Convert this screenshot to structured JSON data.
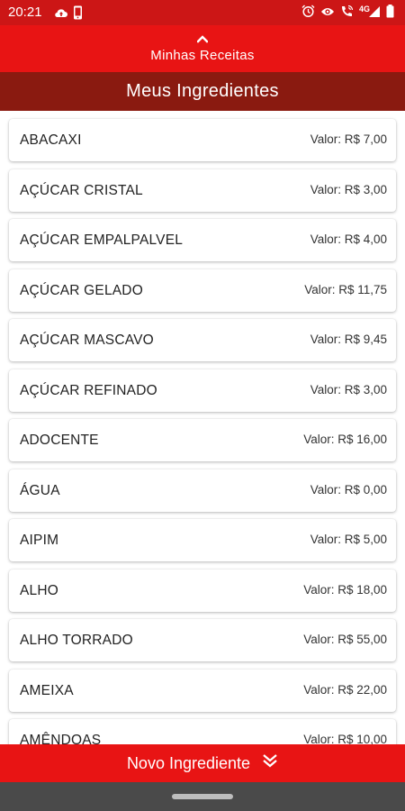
{
  "status_bar": {
    "time": "20:21",
    "network": "4G",
    "left_icons": [
      "cloud-upload-icon",
      "notification-phone-icon"
    ],
    "right_icons": [
      "alarm-icon",
      "eye-icon",
      "wifi-calling-icon",
      "signal-icon",
      "battery-icon"
    ]
  },
  "header": {
    "recipes_label": "Minhas Receitas",
    "title": "Meus Ingredientes"
  },
  "ingredients": [
    {
      "name": "ABACAXI",
      "price": "Valor: R$ 7,00"
    },
    {
      "name": "AÇÚCAR CRISTAL",
      "price": "Valor: R$ 3,00"
    },
    {
      "name": "AÇÚCAR EMPALPALVEL",
      "price": "Valor: R$ 4,00"
    },
    {
      "name": "AÇÚCAR GELADO",
      "price": "Valor: R$ 11,75"
    },
    {
      "name": "AÇÚCAR MASCAVO",
      "price": "Valor: R$ 9,45"
    },
    {
      "name": "AÇÚCAR REFINADO",
      "price": "Valor: R$ 3,00"
    },
    {
      "name": "ADOCENTE",
      "price": "Valor: R$ 16,00"
    },
    {
      "name": "ÁGUA",
      "price": "Valor: R$ 0,00"
    },
    {
      "name": "AIPIM",
      "price": "Valor: R$ 5,00"
    },
    {
      "name": "ALHO",
      "price": "Valor: R$ 18,00"
    },
    {
      "name": "ALHO TORRADO",
      "price": "Valor: R$ 55,00"
    },
    {
      "name": "AMEIXA",
      "price": "Valor: R$ 22,00"
    },
    {
      "name": "AMÊNDOAS",
      "price": "Valor: R$ 10,00"
    }
  ],
  "footer": {
    "new_ingredient_label": "Novo Ingrediente"
  },
  "colors": {
    "primary_red": "#e81414",
    "dark_red": "#8a1a10",
    "nav_gray": "#4a4a4a"
  }
}
